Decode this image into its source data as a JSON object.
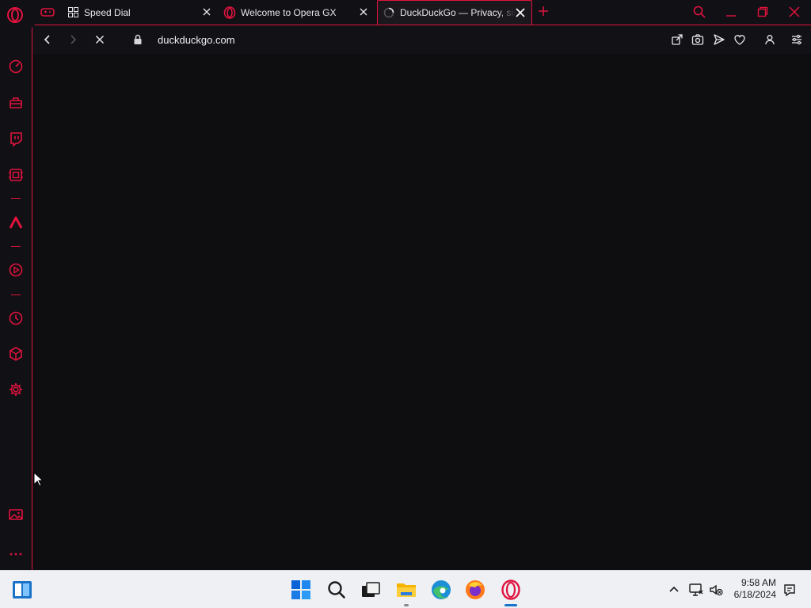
{
  "browser": {
    "tabs": [
      {
        "title": "Speed Dial",
        "icon": "grid-icon",
        "active": false
      },
      {
        "title": "Welcome to Opera GX",
        "icon": "opera-gx-icon",
        "active": false
      },
      {
        "title": "DuckDuckGo — Privacy, simplified.",
        "icon": "loading-spinner-icon",
        "active": true
      }
    ],
    "address": {
      "url": "duckduckgo.com",
      "secure": true,
      "loading": true
    },
    "toolbar_icons": [
      "share-icon",
      "camera-icon",
      "send-icon",
      "heart-icon",
      "account-icon",
      "easy-setup-icon"
    ],
    "sidebar_icons": [
      "gx-control-icon",
      "gx-corner-icon",
      "twitch-icon",
      "player-icon",
      "aria-icon",
      "video-popout-icon",
      "history-icon",
      "extensions-icon",
      "settings-icon",
      "wallpaper-icon",
      "more-icon"
    ],
    "accent": "#e0133e"
  },
  "taskbar": {
    "time": "9:58 AM",
    "date": "6/18/2024",
    "apps": [
      "start-icon",
      "search-icon",
      "task-view-icon",
      "file-explorer-icon",
      "edge-icon",
      "firefox-icon",
      "opera-gx-icon"
    ]
  }
}
